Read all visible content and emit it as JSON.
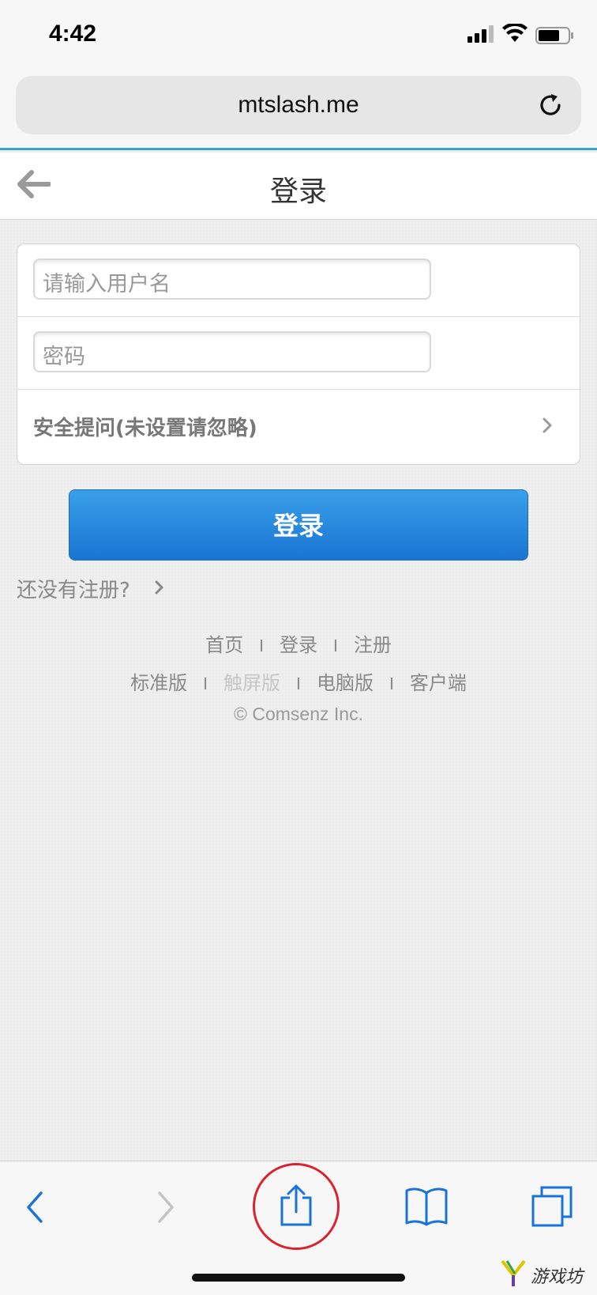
{
  "status": {
    "time": "4:42"
  },
  "browser": {
    "url": "mtslash.me"
  },
  "header": {
    "title": "登录"
  },
  "form": {
    "username_placeholder": "请输入用户名",
    "password_placeholder": "密码",
    "security_question_label": "安全提问(未设置请忽略)",
    "submit_label": "登录"
  },
  "register_hint": "还没有注册?",
  "footer": {
    "row1": [
      "首页",
      "登录",
      "注册"
    ],
    "row2": [
      "标准版",
      "触屏版",
      "电脑版",
      "客户端"
    ],
    "separator": "I",
    "copyright": "© Comsenz Inc."
  },
  "watermark": "游戏坊",
  "colors": {
    "accent": "#3ea3c9",
    "button_top": "#3aa0ea",
    "button_bottom": "#1a74d2",
    "toolbar_icon": "#1a73d9",
    "highlight_ring": "#d9242f"
  }
}
